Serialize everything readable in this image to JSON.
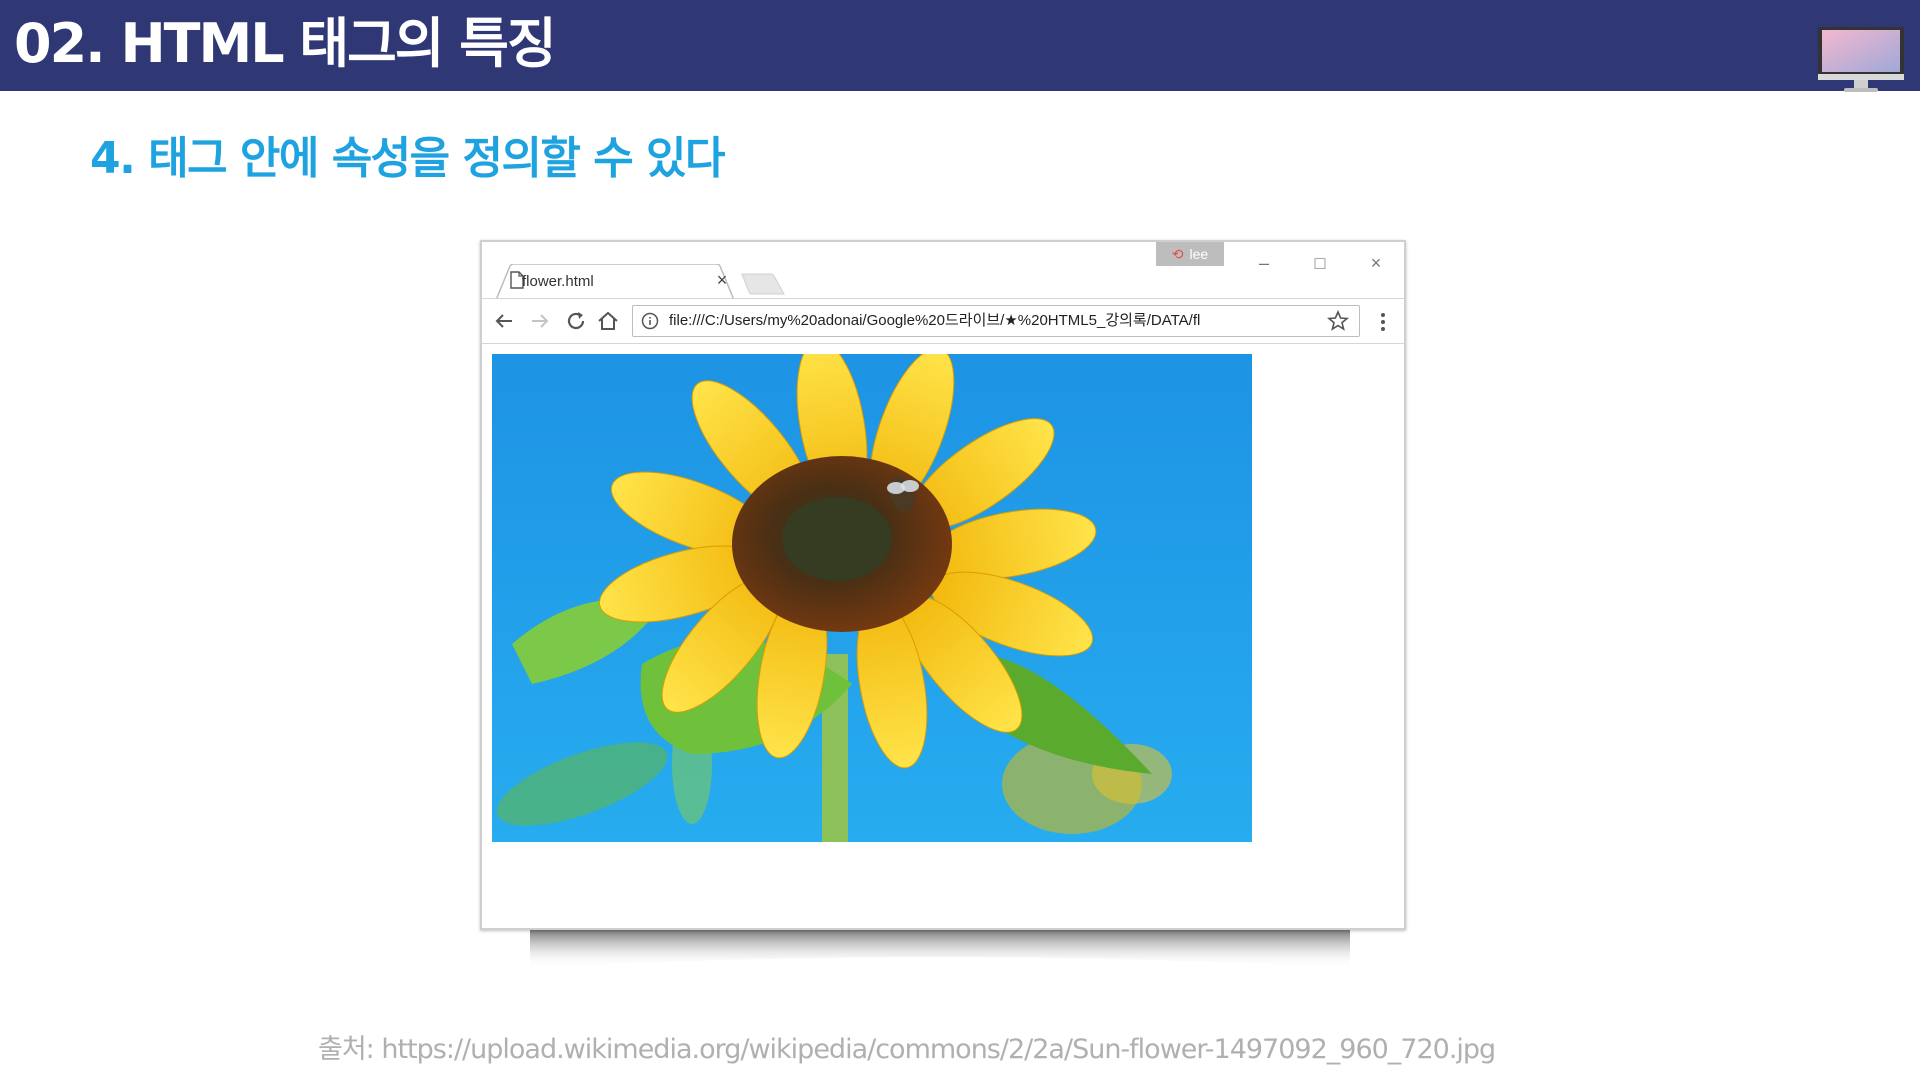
{
  "header": {
    "title": "02. HTML 태그의 특징"
  },
  "subtitle": "4. 태그 안에 속성을 정의할 수 있다",
  "browser": {
    "user_badge": "lee",
    "tab": {
      "title": "flower.html",
      "close": "×"
    },
    "url": "file:///C:/Users/my%20adonai/Google%20드라이브/★%20HTML5_강의록/DATA/fl",
    "window_controls": {
      "minimize": "–",
      "maximize": "□",
      "close": "×"
    }
  },
  "image": {
    "subject": "sunflower with bee against blue sky"
  },
  "source_caption": "출처: https://upload.wikimedia.org/wikipedia/commons/2/2a/Sun-flower-1497092_960_720.jpg",
  "icons": [
    "monitor-icon",
    "page-icon",
    "back-icon",
    "forward-icon",
    "reload-icon",
    "home-icon",
    "info-icon",
    "star-icon",
    "menu-icon"
  ],
  "colors": {
    "header_bg": "#2f3774",
    "subtitle": "#1fa3e0",
    "sky": "#1f9fe6",
    "petal": "#f7d21c"
  }
}
